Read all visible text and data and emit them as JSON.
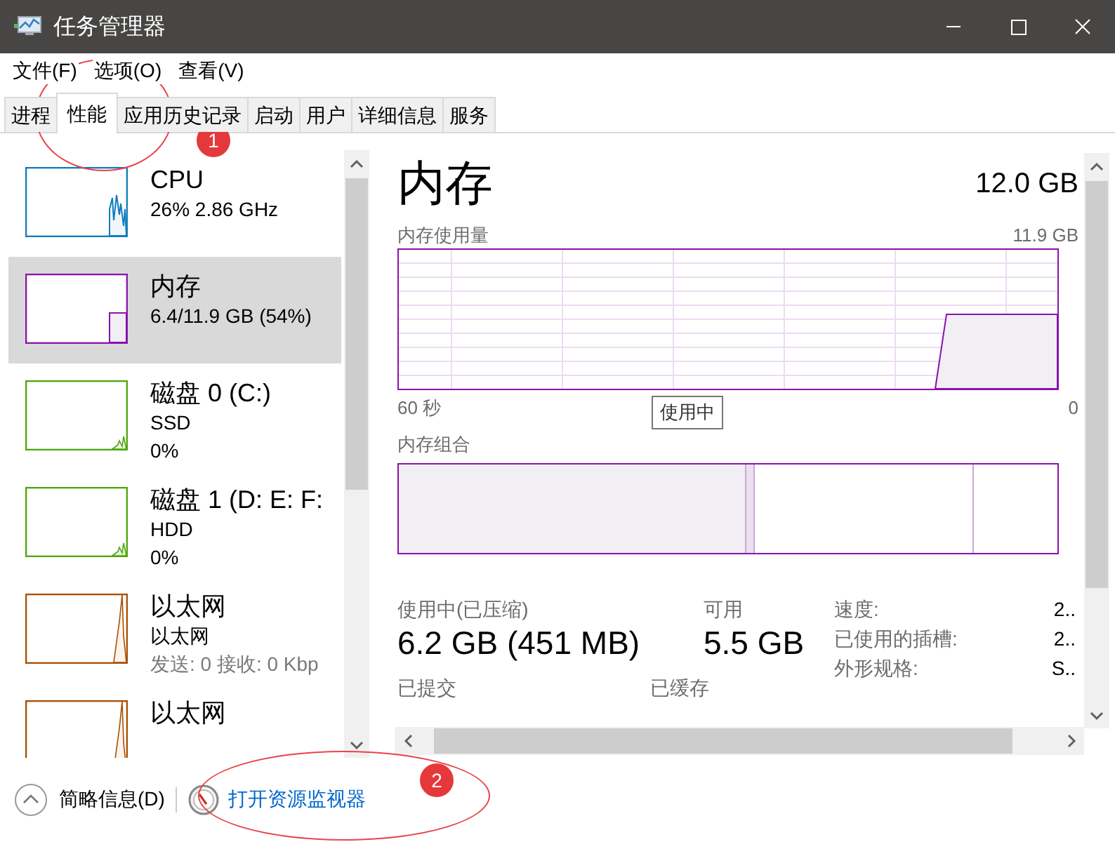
{
  "window": {
    "title": "任务管理器"
  },
  "menu": [
    "文件(F)",
    "选项(O)",
    "查看(V)"
  ],
  "tabs": [
    {
      "label": "进程",
      "selected": false
    },
    {
      "label": "性能",
      "selected": true
    },
    {
      "label": "应用历史记录",
      "selected": false
    },
    {
      "label": "启动",
      "selected": false
    },
    {
      "label": "用户",
      "selected": false
    },
    {
      "label": "详细信息",
      "selected": false
    },
    {
      "label": "服务",
      "selected": false
    }
  ],
  "devices": [
    {
      "kind": "cpu",
      "name": "CPU",
      "color": "#117dbb",
      "selected": false,
      "lines": [
        {
          "text": "26% 2.86 GHz",
          "dim": false
        }
      ]
    },
    {
      "kind": "memory",
      "name": "内存",
      "color": "#8b12ae",
      "selected": true,
      "lines": [
        {
          "text": "6.4/11.9 GB (54%)",
          "dim": false
        }
      ]
    },
    {
      "kind": "disk",
      "name": "磁盘 0 (C:)",
      "color": "#4da60c",
      "selected": false,
      "lines": [
        {
          "text": "SSD",
          "dim": false
        },
        {
          "text": "0%",
          "dim": false
        }
      ]
    },
    {
      "kind": "disk",
      "name": "磁盘 1 (D: E: F:",
      "color": "#4da60c",
      "selected": false,
      "lines": [
        {
          "text": "HDD",
          "dim": false
        },
        {
          "text": "0%",
          "dim": false
        }
      ]
    },
    {
      "kind": "ethernet",
      "name": "以太网",
      "color": "#a74f01",
      "selected": false,
      "lines": [
        {
          "text": "以太网",
          "dim": false
        },
        {
          "text": "发送: 0 接收: 0 Kbp",
          "dim": true
        }
      ]
    },
    {
      "kind": "ethernet",
      "name": "以太网",
      "color": "#a74f01",
      "selected": false
    }
  ],
  "detail": {
    "title": "内存",
    "total": "12.0 GB",
    "usage_label": "内存使用量",
    "usage_max": "11.9 GB",
    "time_start": "60 秒",
    "time_end": "0",
    "tooltip": "使用中",
    "composition_label": "内存组合",
    "stat_rows": [
      [
        {
          "label": "使用中(已压缩)",
          "value": "6.2 GB (451 MB)"
        },
        {
          "label": "可用",
          "value": "5.5 GB"
        }
      ],
      [
        {
          "label": "已提交"
        },
        {
          "label": "已缓存"
        }
      ]
    ],
    "properties": [
      {
        "label": "速度:",
        "value": "2.."
      },
      {
        "label": "已使用的插槽:",
        "value": "2.."
      },
      {
        "label": "外形规格:",
        "value": "S.."
      }
    ]
  },
  "footer": {
    "summary": "简略信息(D)",
    "monitor_link": "打开资源监视器"
  },
  "annotations": [
    {
      "number": "1"
    },
    {
      "number": "2"
    }
  ]
}
